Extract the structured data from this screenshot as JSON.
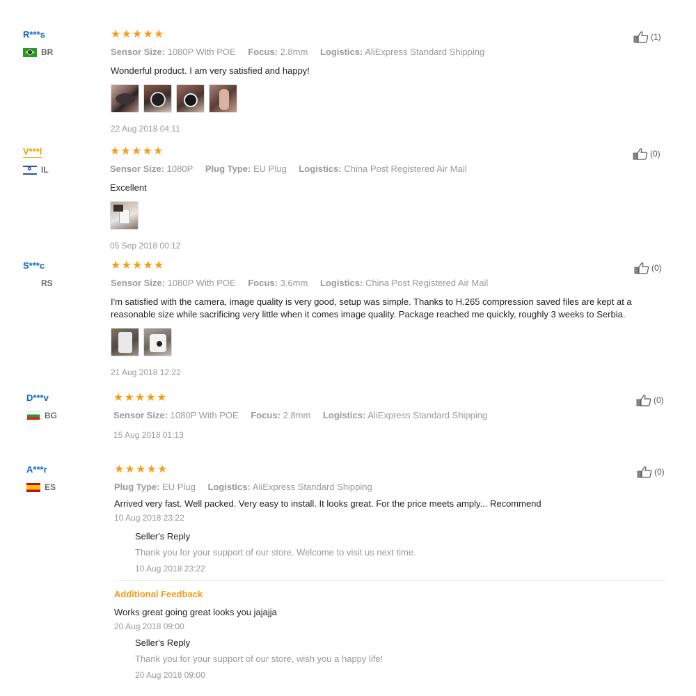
{
  "reviews": [
    {
      "user": "R***s",
      "country": "BR",
      "meta": [
        {
          "key": "Sensor Size:",
          "value": "1080P With POE"
        },
        {
          "key": "Focus:",
          "value": "2.8mm"
        },
        {
          "key": "Logistics:",
          "value": "AliExpress Standard Shipping"
        }
      ],
      "comment": "Wonderful product. I am very satisfied and happy!",
      "date": "22 Aug 2018 04:11",
      "likes": "(1)"
    },
    {
      "user": "V***l",
      "country": "IL",
      "meta": [
        {
          "key": "Sensor Size:",
          "value": "1080P"
        },
        {
          "key": "Plug Type:",
          "value": "EU Plug"
        },
        {
          "key": "Logistics:",
          "value": "China Post Registered Air Mail"
        }
      ],
      "comment": "Excellent",
      "date": "05 Sep 2018 00:12",
      "likes": "(0)"
    },
    {
      "user": "S***c",
      "country": "RS",
      "meta": [
        {
          "key": "Sensor Size:",
          "value": "1080P With POE"
        },
        {
          "key": "Focus:",
          "value": "3.6mm"
        },
        {
          "key": "Logistics:",
          "value": "China Post Registered Air Mail"
        }
      ],
      "comment_line1": "I'm satisfied with the camera, image quality is very good, setup was simple. Thanks to H.265 compression saved files are kept at a",
      "comment_line2": "reasonable size while sacrificing very little when it comes image quality. Package reached me quickly, roughly 3 weeks to Serbia.",
      "date": "21 Aug 2018 12:22",
      "likes": "(0)"
    },
    {
      "user": "D***v",
      "country": "BG",
      "meta": [
        {
          "key": "Sensor Size:",
          "value": "1080P With POE"
        },
        {
          "key": "Focus:",
          "value": "2.8mm"
        },
        {
          "key": "Logistics:",
          "value": "AliExpress Standard Shipping"
        }
      ],
      "date": "15 Aug 2018 01:13",
      "likes": "(0)"
    },
    {
      "user": "A***r",
      "country": "ES",
      "meta": [
        {
          "key": "Plug Type:",
          "value": "EU Plug"
        },
        {
          "key": "Logistics:",
          "value": "AliExpress Standard Shipping"
        }
      ],
      "comment": "Arrived very fast. Well packed. Very easy to install. It looks great. For the price meets amply... Recommend",
      "date": "10 Aug 2018 23:22",
      "seller_reply_title": "Seller's Reply",
      "seller_reply_text": "Thank you for your support of our store. Welcome to visit us next time.",
      "seller_reply_date": "10 Aug 2018 23:22",
      "additional_title": "Additional Feedback",
      "additional_text": "Works great going great looks you jajajja",
      "additional_date": "20 Aug 2018 09:00",
      "seller_reply2_title": "Seller's Reply",
      "seller_reply2_text": "Thank you for your support of our store, wish you a happy life!",
      "seller_reply2_date": "20 Aug 2018 09:00",
      "likes": "(0)"
    }
  ],
  "colors": {
    "star": "#f89c16",
    "username": "#1166c9",
    "username_gold": "#e7a300",
    "additional_feedback": "#f39c12",
    "muted": "#999999"
  },
  "icons": {
    "rating": "star-icon",
    "like": "thumbs-up-icon"
  }
}
